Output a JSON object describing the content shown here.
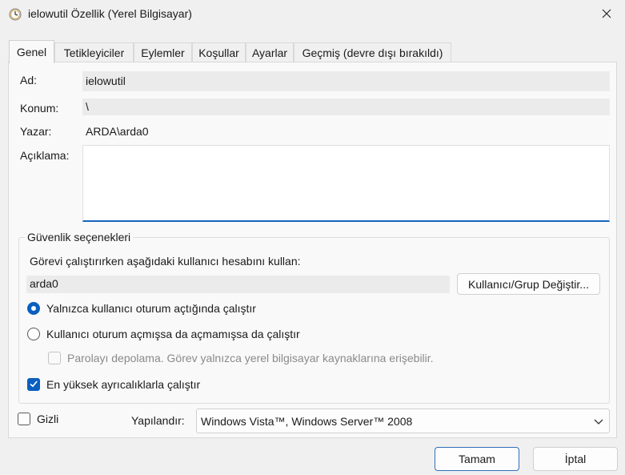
{
  "window": {
    "title": "ielowutil Özellik (Yerel Bilgisayar)",
    "icons": {
      "app": "clock-icon",
      "close": "close-icon"
    }
  },
  "tabs": [
    {
      "label": "Genel",
      "active": true
    },
    {
      "label": "Tetikleyiciler",
      "active": false
    },
    {
      "label": "Eylemler",
      "active": false
    },
    {
      "label": "Koşullar",
      "active": false
    },
    {
      "label": "Ayarlar",
      "active": false
    },
    {
      "label": "Geçmiş (devre dışı bırakıldı)",
      "active": false
    }
  ],
  "general": {
    "name_label": "Ad:",
    "name_value": "ielowutil",
    "location_label": "Konum:",
    "location_value": "\\",
    "author_label": "Yazar:",
    "author_value": "ARDA\\arda0",
    "description_label": "Açıklama:",
    "description_value": ""
  },
  "security": {
    "group_title": "Güvenlik seçenekleri",
    "account_prompt": "Görevi çalıştırırken aşağıdaki kullanıcı hesabını kullan:",
    "account_value": "arda0",
    "change_user_button": "Kullanıcı/Grup Değiştir...",
    "radio_logged_on": {
      "label": "Yalnızca kullanıcı oturum açtığında çalıştır",
      "selected": true
    },
    "radio_whether": {
      "label": "Kullanıcı oturum açmışsa da açmamışsa da çalıştır",
      "selected": false
    },
    "no_store_password": {
      "label": "Parolayı depolama. Görev yalnızca yerel bilgisayar kaynaklarına erişebilir.",
      "checked": false,
      "enabled": false
    },
    "highest_privileges": {
      "label": "En yüksek ayrıcalıklarla çalıştır",
      "checked": true
    }
  },
  "footer": {
    "hidden_label": "Gizli",
    "hidden_checked": false,
    "configure_label": "Yapılandır:",
    "configure_value": "Windows Vista™, Windows Server™ 2008",
    "ok_button": "Tamam",
    "cancel_button": "İptal"
  },
  "colors": {
    "accent": "#0a5fbf",
    "background": "#f0f0f0",
    "panel": "#f9f9f9"
  }
}
